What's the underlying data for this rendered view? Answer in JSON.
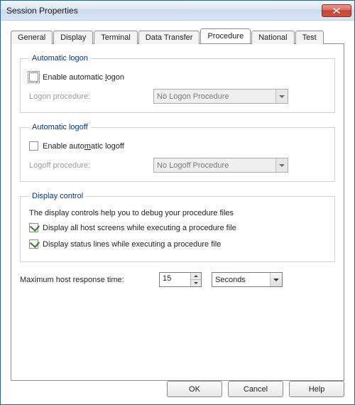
{
  "window": {
    "title": "Session Properties"
  },
  "tabs": {
    "general": "General",
    "display": "Display",
    "terminal": "Terminal",
    "data_transfer": "Data Transfer",
    "procedure": "Procedure",
    "national": "National",
    "test": "Test",
    "active": "procedure"
  },
  "logon": {
    "legend": "Automatic logon",
    "enable_label_pre": "Enable automatic ",
    "enable_label_key": "l",
    "enable_label_post": "ogon",
    "enable_checked": false,
    "proc_label": "Logon procedure:",
    "proc_value": "No Logon Procedure"
  },
  "logoff": {
    "legend": "Automatic logoff",
    "enable_label_pre": "Enable auto",
    "enable_label_key": "m",
    "enable_label_post": "atic logoff",
    "enable_checked": false,
    "proc_label": "Logoff procedure:",
    "proc_value": "No Logoff Procedure"
  },
  "display_ctrl": {
    "legend": "Display control",
    "help_text": "The display controls help you to debug your procedure files",
    "all_host_label": "Display all host screens while executing a procedure file",
    "all_host_checked": true,
    "status_label": "Display status lines while executing a procedure file",
    "status_checked": true
  },
  "response": {
    "label": "Maximum host response time:",
    "value": "15",
    "unit": "Seconds"
  },
  "buttons": {
    "ok": "OK",
    "cancel": "Cancel",
    "help": "Help"
  }
}
